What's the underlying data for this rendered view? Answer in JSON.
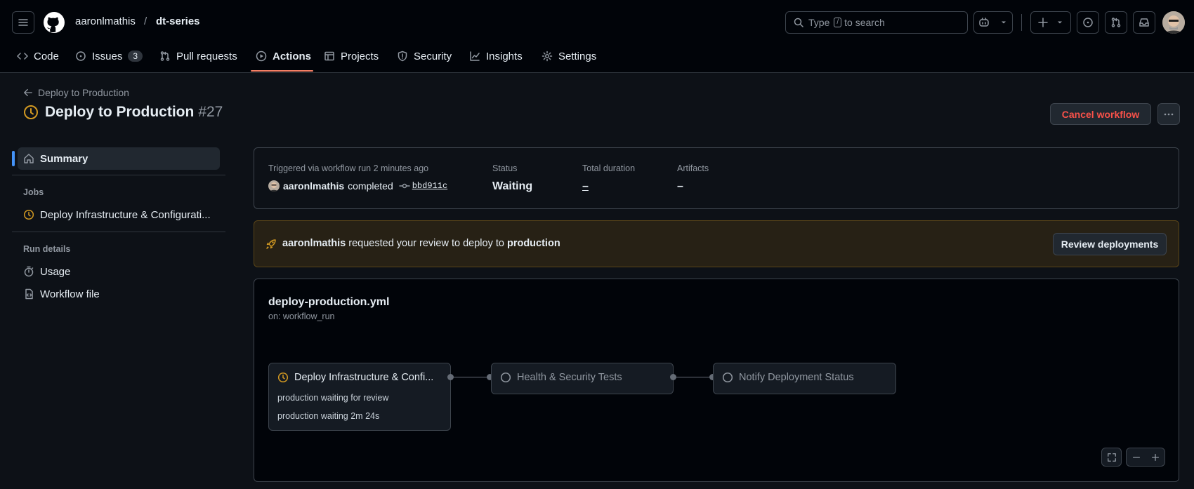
{
  "header": {
    "owner": "aaronlmathis",
    "separator": "/",
    "repo": "dt-series",
    "search_prefix": "Type",
    "search_key": "/",
    "search_suffix": "to search"
  },
  "nav": {
    "tabs": [
      {
        "label": "Code",
        "icon": "code-icon"
      },
      {
        "label": "Issues",
        "icon": "issue-icon",
        "count": "3"
      },
      {
        "label": "Pull requests",
        "icon": "pull-request-icon"
      },
      {
        "label": "Actions",
        "icon": "play-icon",
        "active": true
      },
      {
        "label": "Projects",
        "icon": "table-icon"
      },
      {
        "label": "Security",
        "icon": "shield-icon"
      },
      {
        "label": "Insights",
        "icon": "graph-icon"
      },
      {
        "label": "Settings",
        "icon": "gear-icon"
      }
    ]
  },
  "run": {
    "back_label": "Deploy to Production",
    "title": "Deploy to Production",
    "number": "#27",
    "cancel_label": "Cancel workflow"
  },
  "sidebar": {
    "summary_label": "Summary",
    "jobs_heading": "Jobs",
    "job_label": "Deploy Infrastructure & Configurati...",
    "run_details_heading": "Run details",
    "usage_label": "Usage",
    "workflow_file_label": "Workflow file"
  },
  "summary": {
    "trigger_label": "Triggered via workflow run 2 minutes ago",
    "actor": "aaronlmathis",
    "action": "completed",
    "commit": "bbd911c",
    "status_label": "Status",
    "status_value": "Waiting",
    "duration_label": "Total duration",
    "duration_value": "–",
    "artifacts_label": "Artifacts",
    "artifacts_value": "–"
  },
  "review": {
    "actor": "aaronlmathis",
    "text": "requested your review to deploy to",
    "environment": "production",
    "button_label": "Review deployments"
  },
  "workflow": {
    "filename": "deploy-production.yml",
    "trigger": "on: workflow_run",
    "jobs": [
      {
        "name": "Deploy Infrastructure & Confi...",
        "status": "waiting",
        "notes": [
          "production waiting for review",
          "production waiting 2m 24s"
        ]
      },
      {
        "name": "Health & Security Tests",
        "status": "queued"
      },
      {
        "name": "Notify Deployment Status",
        "status": "queued"
      }
    ]
  },
  "colors": {
    "accent_tab": "#f78166",
    "waiting": "#d29922",
    "danger": "#f85149",
    "review_bg": "#272115",
    "review_border": "#5a4518"
  }
}
